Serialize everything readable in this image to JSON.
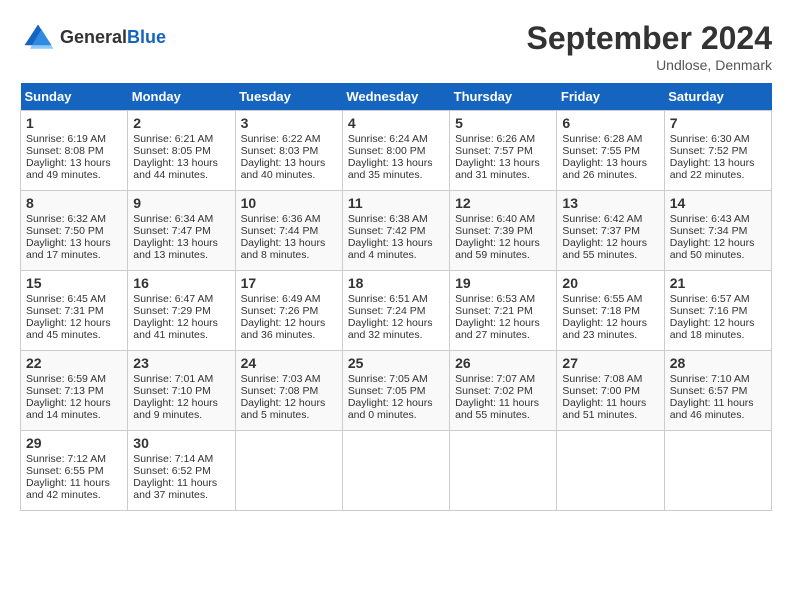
{
  "header": {
    "logo_general": "General",
    "logo_blue": "Blue",
    "month": "September 2024",
    "location": "Undlose, Denmark"
  },
  "days_of_week": [
    "Sunday",
    "Monday",
    "Tuesday",
    "Wednesday",
    "Thursday",
    "Friday",
    "Saturday"
  ],
  "weeks": [
    [
      {
        "day": 1,
        "lines": [
          "Sunrise: 6:19 AM",
          "Sunset: 8:08 PM",
          "Daylight: 13 hours",
          "and 49 minutes."
        ]
      },
      {
        "day": 2,
        "lines": [
          "Sunrise: 6:21 AM",
          "Sunset: 8:05 PM",
          "Daylight: 13 hours",
          "and 44 minutes."
        ]
      },
      {
        "day": 3,
        "lines": [
          "Sunrise: 6:22 AM",
          "Sunset: 8:03 PM",
          "Daylight: 13 hours",
          "and 40 minutes."
        ]
      },
      {
        "day": 4,
        "lines": [
          "Sunrise: 6:24 AM",
          "Sunset: 8:00 PM",
          "Daylight: 13 hours",
          "and 35 minutes."
        ]
      },
      {
        "day": 5,
        "lines": [
          "Sunrise: 6:26 AM",
          "Sunset: 7:57 PM",
          "Daylight: 13 hours",
          "and 31 minutes."
        ]
      },
      {
        "day": 6,
        "lines": [
          "Sunrise: 6:28 AM",
          "Sunset: 7:55 PM",
          "Daylight: 13 hours",
          "and 26 minutes."
        ]
      },
      {
        "day": 7,
        "lines": [
          "Sunrise: 6:30 AM",
          "Sunset: 7:52 PM",
          "Daylight: 13 hours",
          "and 22 minutes."
        ]
      }
    ],
    [
      {
        "day": 8,
        "lines": [
          "Sunrise: 6:32 AM",
          "Sunset: 7:50 PM",
          "Daylight: 13 hours",
          "and 17 minutes."
        ]
      },
      {
        "day": 9,
        "lines": [
          "Sunrise: 6:34 AM",
          "Sunset: 7:47 PM",
          "Daylight: 13 hours",
          "and 13 minutes."
        ]
      },
      {
        "day": 10,
        "lines": [
          "Sunrise: 6:36 AM",
          "Sunset: 7:44 PM",
          "Daylight: 13 hours",
          "and 8 minutes."
        ]
      },
      {
        "day": 11,
        "lines": [
          "Sunrise: 6:38 AM",
          "Sunset: 7:42 PM",
          "Daylight: 13 hours",
          "and 4 minutes."
        ]
      },
      {
        "day": 12,
        "lines": [
          "Sunrise: 6:40 AM",
          "Sunset: 7:39 PM",
          "Daylight: 12 hours",
          "and 59 minutes."
        ]
      },
      {
        "day": 13,
        "lines": [
          "Sunrise: 6:42 AM",
          "Sunset: 7:37 PM",
          "Daylight: 12 hours",
          "and 55 minutes."
        ]
      },
      {
        "day": 14,
        "lines": [
          "Sunrise: 6:43 AM",
          "Sunset: 7:34 PM",
          "Daylight: 12 hours",
          "and 50 minutes."
        ]
      }
    ],
    [
      {
        "day": 15,
        "lines": [
          "Sunrise: 6:45 AM",
          "Sunset: 7:31 PM",
          "Daylight: 12 hours",
          "and 45 minutes."
        ]
      },
      {
        "day": 16,
        "lines": [
          "Sunrise: 6:47 AM",
          "Sunset: 7:29 PM",
          "Daylight: 12 hours",
          "and 41 minutes."
        ]
      },
      {
        "day": 17,
        "lines": [
          "Sunrise: 6:49 AM",
          "Sunset: 7:26 PM",
          "Daylight: 12 hours",
          "and 36 minutes."
        ]
      },
      {
        "day": 18,
        "lines": [
          "Sunrise: 6:51 AM",
          "Sunset: 7:24 PM",
          "Daylight: 12 hours",
          "and 32 minutes."
        ]
      },
      {
        "day": 19,
        "lines": [
          "Sunrise: 6:53 AM",
          "Sunset: 7:21 PM",
          "Daylight: 12 hours",
          "and 27 minutes."
        ]
      },
      {
        "day": 20,
        "lines": [
          "Sunrise: 6:55 AM",
          "Sunset: 7:18 PM",
          "Daylight: 12 hours",
          "and 23 minutes."
        ]
      },
      {
        "day": 21,
        "lines": [
          "Sunrise: 6:57 AM",
          "Sunset: 7:16 PM",
          "Daylight: 12 hours",
          "and 18 minutes."
        ]
      }
    ],
    [
      {
        "day": 22,
        "lines": [
          "Sunrise: 6:59 AM",
          "Sunset: 7:13 PM",
          "Daylight: 12 hours",
          "and 14 minutes."
        ]
      },
      {
        "day": 23,
        "lines": [
          "Sunrise: 7:01 AM",
          "Sunset: 7:10 PM",
          "Daylight: 12 hours",
          "and 9 minutes."
        ]
      },
      {
        "day": 24,
        "lines": [
          "Sunrise: 7:03 AM",
          "Sunset: 7:08 PM",
          "Daylight: 12 hours",
          "and 5 minutes."
        ]
      },
      {
        "day": 25,
        "lines": [
          "Sunrise: 7:05 AM",
          "Sunset: 7:05 PM",
          "Daylight: 12 hours",
          "and 0 minutes."
        ]
      },
      {
        "day": 26,
        "lines": [
          "Sunrise: 7:07 AM",
          "Sunset: 7:02 PM",
          "Daylight: 11 hours",
          "and 55 minutes."
        ]
      },
      {
        "day": 27,
        "lines": [
          "Sunrise: 7:08 AM",
          "Sunset: 7:00 PM",
          "Daylight: 11 hours",
          "and 51 minutes."
        ]
      },
      {
        "day": 28,
        "lines": [
          "Sunrise: 7:10 AM",
          "Sunset: 6:57 PM",
          "Daylight: 11 hours",
          "and 46 minutes."
        ]
      }
    ],
    [
      {
        "day": 29,
        "lines": [
          "Sunrise: 7:12 AM",
          "Sunset: 6:55 PM",
          "Daylight: 11 hours",
          "and 42 minutes."
        ]
      },
      {
        "day": 30,
        "lines": [
          "Sunrise: 7:14 AM",
          "Sunset: 6:52 PM",
          "Daylight: 11 hours",
          "and 37 minutes."
        ]
      },
      null,
      null,
      null,
      null,
      null
    ]
  ]
}
